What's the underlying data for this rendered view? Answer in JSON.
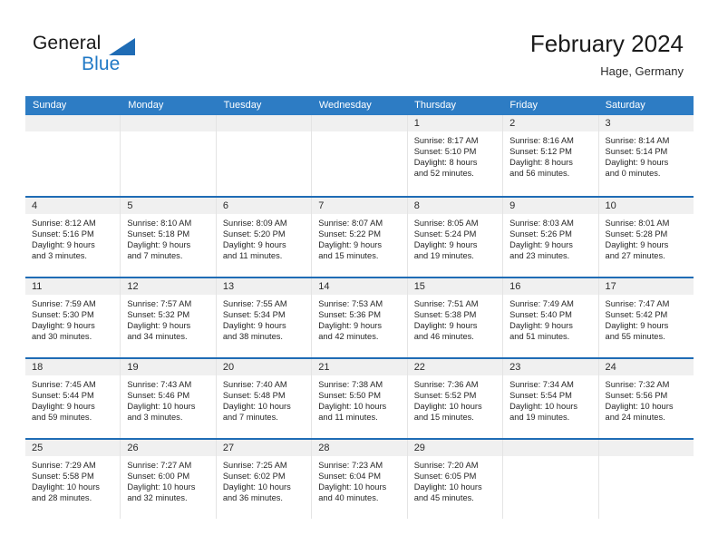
{
  "brand": {
    "name_top": "General",
    "name_bottom": "Blue",
    "triangle_color": "#1f6cb5",
    "blue_color": "#2079c6"
  },
  "header": {
    "title": "February 2024",
    "location": "Hage, Germany"
  },
  "theme": {
    "header_row_bg": "#2d7cc4",
    "week_divider": "#1f6cb5",
    "daynum_band": "#f0f0f0",
    "cell_divider": "#e4e4e4"
  },
  "weekdays": [
    "Sunday",
    "Monday",
    "Tuesday",
    "Wednesday",
    "Thursday",
    "Friday",
    "Saturday"
  ],
  "weeks": [
    [
      {
        "day": "",
        "lines": []
      },
      {
        "day": "",
        "lines": []
      },
      {
        "day": "",
        "lines": []
      },
      {
        "day": "",
        "lines": []
      },
      {
        "day": "1",
        "lines": [
          "Sunrise: 8:17 AM",
          "Sunset: 5:10 PM",
          "Daylight: 8 hours",
          "and 52 minutes."
        ]
      },
      {
        "day": "2",
        "lines": [
          "Sunrise: 8:16 AM",
          "Sunset: 5:12 PM",
          "Daylight: 8 hours",
          "and 56 minutes."
        ]
      },
      {
        "day": "3",
        "lines": [
          "Sunrise: 8:14 AM",
          "Sunset: 5:14 PM",
          "Daylight: 9 hours",
          "and 0 minutes."
        ]
      }
    ],
    [
      {
        "day": "4",
        "lines": [
          "Sunrise: 8:12 AM",
          "Sunset: 5:16 PM",
          "Daylight: 9 hours",
          "and 3 minutes."
        ]
      },
      {
        "day": "5",
        "lines": [
          "Sunrise: 8:10 AM",
          "Sunset: 5:18 PM",
          "Daylight: 9 hours",
          "and 7 minutes."
        ]
      },
      {
        "day": "6",
        "lines": [
          "Sunrise: 8:09 AM",
          "Sunset: 5:20 PM",
          "Daylight: 9 hours",
          "and 11 minutes."
        ]
      },
      {
        "day": "7",
        "lines": [
          "Sunrise: 8:07 AM",
          "Sunset: 5:22 PM",
          "Daylight: 9 hours",
          "and 15 minutes."
        ]
      },
      {
        "day": "8",
        "lines": [
          "Sunrise: 8:05 AM",
          "Sunset: 5:24 PM",
          "Daylight: 9 hours",
          "and 19 minutes."
        ]
      },
      {
        "day": "9",
        "lines": [
          "Sunrise: 8:03 AM",
          "Sunset: 5:26 PM",
          "Daylight: 9 hours",
          "and 23 minutes."
        ]
      },
      {
        "day": "10",
        "lines": [
          "Sunrise: 8:01 AM",
          "Sunset: 5:28 PM",
          "Daylight: 9 hours",
          "and 27 minutes."
        ]
      }
    ],
    [
      {
        "day": "11",
        "lines": [
          "Sunrise: 7:59 AM",
          "Sunset: 5:30 PM",
          "Daylight: 9 hours",
          "and 30 minutes."
        ]
      },
      {
        "day": "12",
        "lines": [
          "Sunrise: 7:57 AM",
          "Sunset: 5:32 PM",
          "Daylight: 9 hours",
          "and 34 minutes."
        ]
      },
      {
        "day": "13",
        "lines": [
          "Sunrise: 7:55 AM",
          "Sunset: 5:34 PM",
          "Daylight: 9 hours",
          "and 38 minutes."
        ]
      },
      {
        "day": "14",
        "lines": [
          "Sunrise: 7:53 AM",
          "Sunset: 5:36 PM",
          "Daylight: 9 hours",
          "and 42 minutes."
        ]
      },
      {
        "day": "15",
        "lines": [
          "Sunrise: 7:51 AM",
          "Sunset: 5:38 PM",
          "Daylight: 9 hours",
          "and 46 minutes."
        ]
      },
      {
        "day": "16",
        "lines": [
          "Sunrise: 7:49 AM",
          "Sunset: 5:40 PM",
          "Daylight: 9 hours",
          "and 51 minutes."
        ]
      },
      {
        "day": "17",
        "lines": [
          "Sunrise: 7:47 AM",
          "Sunset: 5:42 PM",
          "Daylight: 9 hours",
          "and 55 minutes."
        ]
      }
    ],
    [
      {
        "day": "18",
        "lines": [
          "Sunrise: 7:45 AM",
          "Sunset: 5:44 PM",
          "Daylight: 9 hours",
          "and 59 minutes."
        ]
      },
      {
        "day": "19",
        "lines": [
          "Sunrise: 7:43 AM",
          "Sunset: 5:46 PM",
          "Daylight: 10 hours",
          "and 3 minutes."
        ]
      },
      {
        "day": "20",
        "lines": [
          "Sunrise: 7:40 AM",
          "Sunset: 5:48 PM",
          "Daylight: 10 hours",
          "and 7 minutes."
        ]
      },
      {
        "day": "21",
        "lines": [
          "Sunrise: 7:38 AM",
          "Sunset: 5:50 PM",
          "Daylight: 10 hours",
          "and 11 minutes."
        ]
      },
      {
        "day": "22",
        "lines": [
          "Sunrise: 7:36 AM",
          "Sunset: 5:52 PM",
          "Daylight: 10 hours",
          "and 15 minutes."
        ]
      },
      {
        "day": "23",
        "lines": [
          "Sunrise: 7:34 AM",
          "Sunset: 5:54 PM",
          "Daylight: 10 hours",
          "and 19 minutes."
        ]
      },
      {
        "day": "24",
        "lines": [
          "Sunrise: 7:32 AM",
          "Sunset: 5:56 PM",
          "Daylight: 10 hours",
          "and 24 minutes."
        ]
      }
    ],
    [
      {
        "day": "25",
        "lines": [
          "Sunrise: 7:29 AM",
          "Sunset: 5:58 PM",
          "Daylight: 10 hours",
          "and 28 minutes."
        ]
      },
      {
        "day": "26",
        "lines": [
          "Sunrise: 7:27 AM",
          "Sunset: 6:00 PM",
          "Daylight: 10 hours",
          "and 32 minutes."
        ]
      },
      {
        "day": "27",
        "lines": [
          "Sunrise: 7:25 AM",
          "Sunset: 6:02 PM",
          "Daylight: 10 hours",
          "and 36 minutes."
        ]
      },
      {
        "day": "28",
        "lines": [
          "Sunrise: 7:23 AM",
          "Sunset: 6:04 PM",
          "Daylight: 10 hours",
          "and 40 minutes."
        ]
      },
      {
        "day": "29",
        "lines": [
          "Sunrise: 7:20 AM",
          "Sunset: 6:05 PM",
          "Daylight: 10 hours",
          "and 45 minutes."
        ]
      },
      {
        "day": "",
        "lines": []
      },
      {
        "day": "",
        "lines": []
      }
    ]
  ]
}
